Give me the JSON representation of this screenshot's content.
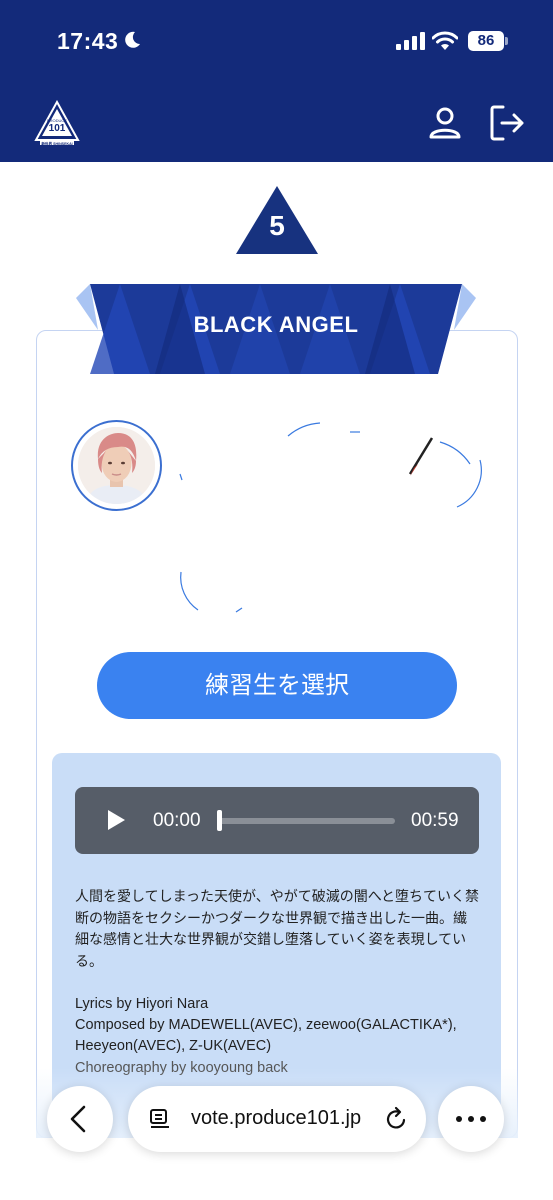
{
  "status_bar": {
    "time": "17:43",
    "battery": "86"
  },
  "header": {
    "logo_text_top": "PRODUCE",
    "logo_text_num": "101",
    "logo_text_bottom": "新世界 SHINSEKAI"
  },
  "song": {
    "number": "5",
    "title": "BLACK ANGEL"
  },
  "select_button": {
    "label": "練習生を選択"
  },
  "player": {
    "current_time": "00:00",
    "duration": "00:59",
    "progress": 0
  },
  "description": {
    "text": "人間を愛してしまった天使が、やがて破滅の闇へと堕ちていく禁断の物語をセクシーかつダークな世界観で描き出した一曲。繊細な感情と壮大な世界観が交錯し堕落していく姿を表現している。"
  },
  "credits": {
    "lyrics": "Lyrics by Hiyori Nara",
    "composed": "Composed by MADEWELL(AVEC), zeewoo(GALACTIKA*), Heeyeon(AVEC), Z-UK(AVEC)",
    "choreography": "Choreography by kooyoung back"
  },
  "browser": {
    "url": "vote.produce101.jp"
  },
  "colors": {
    "header_bg": "#132a7a",
    "accent_blue": "#3a82f0",
    "panel_bg": "#c9ddf7"
  }
}
